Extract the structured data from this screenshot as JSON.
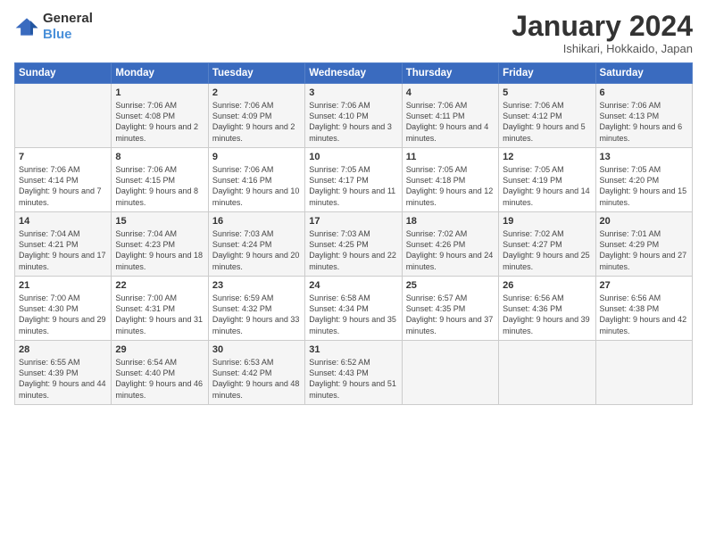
{
  "header": {
    "logo_general": "General",
    "logo_blue": "Blue",
    "month_title": "January 2024",
    "subtitle": "Ishikari, Hokkaido, Japan"
  },
  "days_of_week": [
    "Sunday",
    "Monday",
    "Tuesday",
    "Wednesday",
    "Thursday",
    "Friday",
    "Saturday"
  ],
  "weeks": [
    [
      {
        "day": "",
        "sunrise": "",
        "sunset": "",
        "daylight": ""
      },
      {
        "day": "1",
        "sunrise": "Sunrise: 7:06 AM",
        "sunset": "Sunset: 4:08 PM",
        "daylight": "Daylight: 9 hours and 2 minutes."
      },
      {
        "day": "2",
        "sunrise": "Sunrise: 7:06 AM",
        "sunset": "Sunset: 4:09 PM",
        "daylight": "Daylight: 9 hours and 2 minutes."
      },
      {
        "day": "3",
        "sunrise": "Sunrise: 7:06 AM",
        "sunset": "Sunset: 4:10 PM",
        "daylight": "Daylight: 9 hours and 3 minutes."
      },
      {
        "day": "4",
        "sunrise": "Sunrise: 7:06 AM",
        "sunset": "Sunset: 4:11 PM",
        "daylight": "Daylight: 9 hours and 4 minutes."
      },
      {
        "day": "5",
        "sunrise": "Sunrise: 7:06 AM",
        "sunset": "Sunset: 4:12 PM",
        "daylight": "Daylight: 9 hours and 5 minutes."
      },
      {
        "day": "6",
        "sunrise": "Sunrise: 7:06 AM",
        "sunset": "Sunset: 4:13 PM",
        "daylight": "Daylight: 9 hours and 6 minutes."
      }
    ],
    [
      {
        "day": "7",
        "sunrise": "Sunrise: 7:06 AM",
        "sunset": "Sunset: 4:14 PM",
        "daylight": "Daylight: 9 hours and 7 minutes."
      },
      {
        "day": "8",
        "sunrise": "Sunrise: 7:06 AM",
        "sunset": "Sunset: 4:15 PM",
        "daylight": "Daylight: 9 hours and 8 minutes."
      },
      {
        "day": "9",
        "sunrise": "Sunrise: 7:06 AM",
        "sunset": "Sunset: 4:16 PM",
        "daylight": "Daylight: 9 hours and 10 minutes."
      },
      {
        "day": "10",
        "sunrise": "Sunrise: 7:05 AM",
        "sunset": "Sunset: 4:17 PM",
        "daylight": "Daylight: 9 hours and 11 minutes."
      },
      {
        "day": "11",
        "sunrise": "Sunrise: 7:05 AM",
        "sunset": "Sunset: 4:18 PM",
        "daylight": "Daylight: 9 hours and 12 minutes."
      },
      {
        "day": "12",
        "sunrise": "Sunrise: 7:05 AM",
        "sunset": "Sunset: 4:19 PM",
        "daylight": "Daylight: 9 hours and 14 minutes."
      },
      {
        "day": "13",
        "sunrise": "Sunrise: 7:05 AM",
        "sunset": "Sunset: 4:20 PM",
        "daylight": "Daylight: 9 hours and 15 minutes."
      }
    ],
    [
      {
        "day": "14",
        "sunrise": "Sunrise: 7:04 AM",
        "sunset": "Sunset: 4:21 PM",
        "daylight": "Daylight: 9 hours and 17 minutes."
      },
      {
        "day": "15",
        "sunrise": "Sunrise: 7:04 AM",
        "sunset": "Sunset: 4:23 PM",
        "daylight": "Daylight: 9 hours and 18 minutes."
      },
      {
        "day": "16",
        "sunrise": "Sunrise: 7:03 AM",
        "sunset": "Sunset: 4:24 PM",
        "daylight": "Daylight: 9 hours and 20 minutes."
      },
      {
        "day": "17",
        "sunrise": "Sunrise: 7:03 AM",
        "sunset": "Sunset: 4:25 PM",
        "daylight": "Daylight: 9 hours and 22 minutes."
      },
      {
        "day": "18",
        "sunrise": "Sunrise: 7:02 AM",
        "sunset": "Sunset: 4:26 PM",
        "daylight": "Daylight: 9 hours and 24 minutes."
      },
      {
        "day": "19",
        "sunrise": "Sunrise: 7:02 AM",
        "sunset": "Sunset: 4:27 PM",
        "daylight": "Daylight: 9 hours and 25 minutes."
      },
      {
        "day": "20",
        "sunrise": "Sunrise: 7:01 AM",
        "sunset": "Sunset: 4:29 PM",
        "daylight": "Daylight: 9 hours and 27 minutes."
      }
    ],
    [
      {
        "day": "21",
        "sunrise": "Sunrise: 7:00 AM",
        "sunset": "Sunset: 4:30 PM",
        "daylight": "Daylight: 9 hours and 29 minutes."
      },
      {
        "day": "22",
        "sunrise": "Sunrise: 7:00 AM",
        "sunset": "Sunset: 4:31 PM",
        "daylight": "Daylight: 9 hours and 31 minutes."
      },
      {
        "day": "23",
        "sunrise": "Sunrise: 6:59 AM",
        "sunset": "Sunset: 4:32 PM",
        "daylight": "Daylight: 9 hours and 33 minutes."
      },
      {
        "day": "24",
        "sunrise": "Sunrise: 6:58 AM",
        "sunset": "Sunset: 4:34 PM",
        "daylight": "Daylight: 9 hours and 35 minutes."
      },
      {
        "day": "25",
        "sunrise": "Sunrise: 6:57 AM",
        "sunset": "Sunset: 4:35 PM",
        "daylight": "Daylight: 9 hours and 37 minutes."
      },
      {
        "day": "26",
        "sunrise": "Sunrise: 6:56 AM",
        "sunset": "Sunset: 4:36 PM",
        "daylight": "Daylight: 9 hours and 39 minutes."
      },
      {
        "day": "27",
        "sunrise": "Sunrise: 6:56 AM",
        "sunset": "Sunset: 4:38 PM",
        "daylight": "Daylight: 9 hours and 42 minutes."
      }
    ],
    [
      {
        "day": "28",
        "sunrise": "Sunrise: 6:55 AM",
        "sunset": "Sunset: 4:39 PM",
        "daylight": "Daylight: 9 hours and 44 minutes."
      },
      {
        "day": "29",
        "sunrise": "Sunrise: 6:54 AM",
        "sunset": "Sunset: 4:40 PM",
        "daylight": "Daylight: 9 hours and 46 minutes."
      },
      {
        "day": "30",
        "sunrise": "Sunrise: 6:53 AM",
        "sunset": "Sunset: 4:42 PM",
        "daylight": "Daylight: 9 hours and 48 minutes."
      },
      {
        "day": "31",
        "sunrise": "Sunrise: 6:52 AM",
        "sunset": "Sunset: 4:43 PM",
        "daylight": "Daylight: 9 hours and 51 minutes."
      },
      {
        "day": "",
        "sunrise": "",
        "sunset": "",
        "daylight": ""
      },
      {
        "day": "",
        "sunrise": "",
        "sunset": "",
        "daylight": ""
      },
      {
        "day": "",
        "sunrise": "",
        "sunset": "",
        "daylight": ""
      }
    ]
  ]
}
